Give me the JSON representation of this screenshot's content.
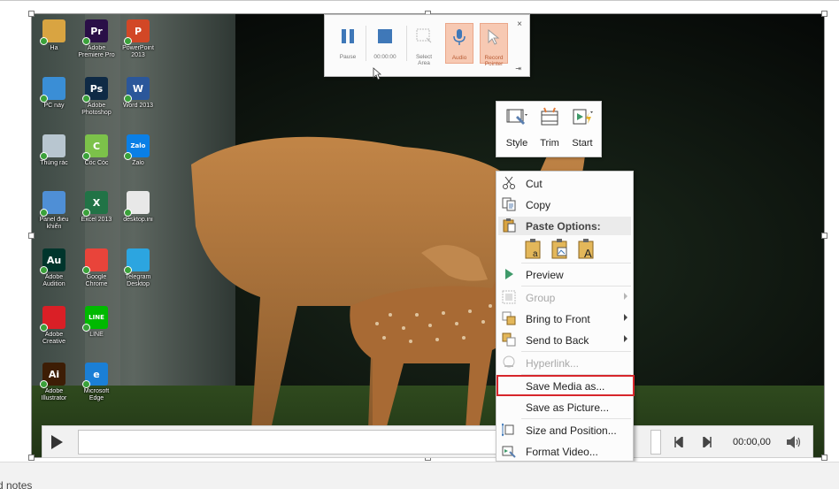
{
  "desktop_icons": [
    {
      "label": "Ha",
      "icon": "user-folder-icon",
      "color": "#d9a441",
      "glyph": ""
    },
    {
      "label": "Adobe Premiere Pro",
      "icon": "premiere-icon",
      "color": "#2a0f47",
      "glyph": "Pr"
    },
    {
      "label": "PowerPoint 2013",
      "icon": "powerpoint-icon",
      "color": "#d24726",
      "glyph": "P"
    },
    {
      "label": "PC này",
      "icon": "computer-icon",
      "color": "#3a8ed6",
      "glyph": ""
    },
    {
      "label": "Adobe Photoshop",
      "icon": "photoshop-icon",
      "color": "#0f2a45",
      "glyph": "Ps"
    },
    {
      "label": "Word 2013",
      "icon": "word-icon",
      "color": "#2b579a",
      "glyph": "W"
    },
    {
      "label": "Thùng rác",
      "icon": "recycle-bin-icon",
      "color": "#b8c6d0",
      "glyph": ""
    },
    {
      "label": "Cốc Cốc",
      "icon": "coccoc-icon",
      "color": "#7cc24a",
      "glyph": "C"
    },
    {
      "label": "Zalo",
      "icon": "zalo-icon",
      "color": "#0a7fe6",
      "glyph": "Zalo"
    },
    {
      "label": "Panel điều khiển",
      "icon": "control-panel-icon",
      "color": "#4f8fd6",
      "glyph": ""
    },
    {
      "label": "Excel 2013",
      "icon": "excel-icon",
      "color": "#217346",
      "glyph": "X"
    },
    {
      "label": "desktop.ini",
      "icon": "ini-file-icon",
      "color": "#e8e8e8",
      "glyph": ""
    },
    {
      "label": "Adobe Audition",
      "icon": "audition-icon",
      "color": "#00352c",
      "glyph": "Au"
    },
    {
      "label": "Google Chrome",
      "icon": "chrome-icon",
      "color": "#e9443a",
      "glyph": ""
    },
    {
      "label": "Telegram Desktop",
      "icon": "telegram-icon",
      "color": "#2ca5e0",
      "glyph": ""
    },
    {
      "label": "Adobe Creative",
      "icon": "creative-cloud-icon",
      "color": "#da1f26",
      "glyph": ""
    },
    {
      "label": "LINE",
      "icon": "line-icon",
      "color": "#00b900",
      "glyph": "LINE"
    },
    {
      "label": "Adobe Illustrator",
      "icon": "illustrator-icon",
      "color": "#3d1d05",
      "glyph": "Ai"
    },
    {
      "label": "Microsoft Edge",
      "icon": "edge-icon",
      "color": "#1b7fd6",
      "glyph": "e"
    }
  ],
  "recording_toolbar": {
    "buttons": [
      {
        "label": "Pause",
        "icon": "pause-icon"
      },
      {
        "label": "00:00:00",
        "icon": "stop-icon"
      },
      {
        "label": "Select Area",
        "icon": "select-area-icon"
      },
      {
        "label": "Audio",
        "icon": "microphone-icon"
      },
      {
        "label": "Record Pointer",
        "icon": "pointer-icon"
      }
    ],
    "close": "×",
    "pin": "⇥"
  },
  "mini_toolbar": {
    "buttons": [
      {
        "label": "Style",
        "icon": "video-style-icon"
      },
      {
        "label": "Trim",
        "icon": "trim-video-icon"
      },
      {
        "label": "Start",
        "icon": "start-video-icon"
      }
    ]
  },
  "context_menu": {
    "cut": "Cut",
    "copy": "Copy",
    "paste_options": "Paste Options:",
    "preview": "Preview",
    "group": "Group",
    "bring_to_front": "Bring to Front",
    "send_to_back": "Send to Back",
    "hyperlink": "Hyperlink...",
    "save_media_as": "Save Media as...",
    "save_as_picture": "Save as Picture...",
    "size_and_position": "Size and Position...",
    "format_video": "Format Video..."
  },
  "media_controls": {
    "time": "00:00,00"
  },
  "notes_label": "d notes",
  "colors": {
    "highlight_border": "#d7262b",
    "record_active_bg": "#f7c9b3",
    "record_icon_blue": "#3f78b8"
  }
}
